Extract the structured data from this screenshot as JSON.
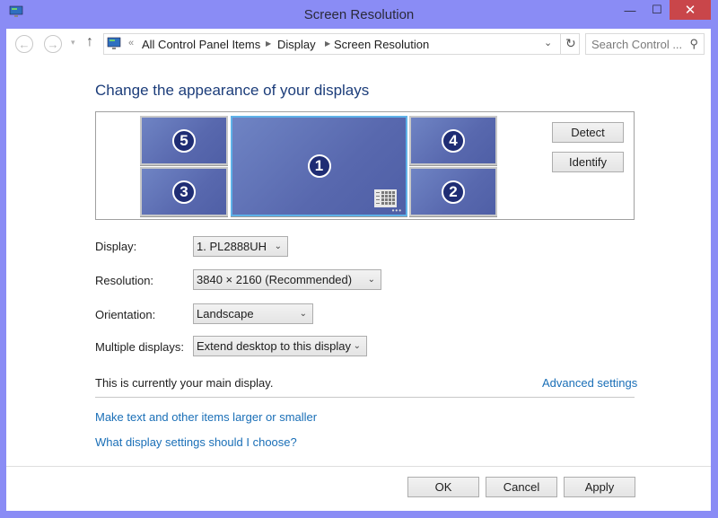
{
  "window": {
    "title": "Screen Resolution",
    "minimize": "—",
    "maximize": "☐",
    "close": "✕"
  },
  "nav": {
    "back": "←",
    "forward": "→",
    "recent": "▾",
    "up": "↑",
    "overflow": "«",
    "breadcrumb": [
      "All Control Panel Items",
      "Display",
      "Screen Resolution"
    ],
    "separator": "▶",
    "dropdown": "⌄",
    "refresh": "↻",
    "search_placeholder": "Search Control ...",
    "search_icon": "⚲"
  },
  "heading": "Change the appearance of your displays",
  "monitors": [
    {
      "id": "5",
      "primary": false
    },
    {
      "id": "3",
      "primary": false
    },
    {
      "id": "1",
      "primary": true
    },
    {
      "id": "4",
      "primary": false
    },
    {
      "id": "2",
      "primary": false
    }
  ],
  "monitor_dots": "•••",
  "buttons": {
    "detect": "Detect",
    "identify": "Identify",
    "ok": "OK",
    "cancel": "Cancel",
    "apply": "Apply"
  },
  "settings": {
    "display": {
      "label": "Display:",
      "value": "1. PL2888UH"
    },
    "resolution": {
      "label": "Resolution:",
      "value": "3840 × 2160 (Recommended)"
    },
    "orientation": {
      "label": "Orientation:",
      "value": "Landscape"
    },
    "multiple": {
      "label": "Multiple displays:",
      "value": "Extend desktop to this display"
    }
  },
  "chevron": "⌄",
  "status_text": "This is currently your main display.",
  "links": {
    "advanced": "Advanced settings",
    "text_size": "Make text and other items larger or smaller",
    "help": "What display settings should I choose?"
  },
  "colors": {
    "titlebar": "#8a8cf5",
    "close": "#c9464a",
    "link": "#1a6fb7",
    "monitor": "#5868ae",
    "primary_border": "#5fb2e8"
  }
}
